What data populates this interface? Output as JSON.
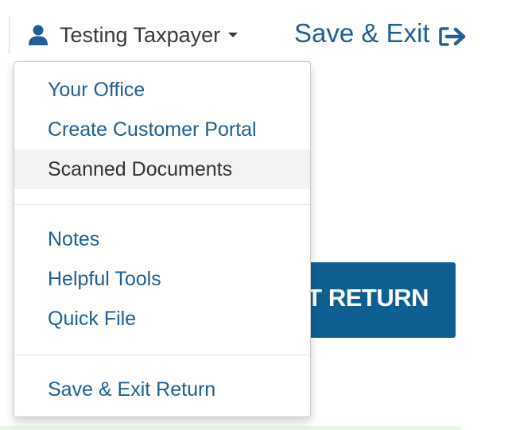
{
  "header": {
    "user_name": "Testing Taxpayer",
    "user_icon": "user-icon",
    "caret_icon": "caret-down-icon",
    "save_exit_label": "Save & Exit",
    "save_exit_icon": "sign-out-icon"
  },
  "menu": {
    "items": [
      {
        "label": "Your Office",
        "active": false
      },
      {
        "label": "Create Customer Portal",
        "active": false
      },
      {
        "label": "Scanned Documents",
        "active": true
      },
      {
        "label": "Notes",
        "active": false
      },
      {
        "label": "Helpful Tools",
        "active": false
      },
      {
        "label": "Quick File",
        "active": false
      },
      {
        "label": "Save & Exit Return",
        "active": false
      }
    ]
  },
  "background_button": {
    "visible_label": "T RETURN"
  },
  "colors": {
    "link": "#1f5f96",
    "button": "#0f5e92",
    "text_dark": "#3a3a3a",
    "hover_bg": "#f3f3f3"
  }
}
